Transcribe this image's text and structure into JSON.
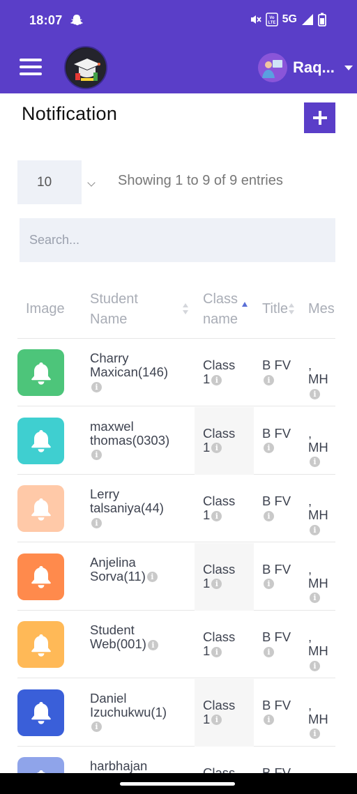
{
  "status_bar": {
    "time": "18:07",
    "network": "5G",
    "icons": [
      "snapchat-icon",
      "mute-icon",
      "volte-icon",
      "signal-icon",
      "battery-icon"
    ]
  },
  "app_bar": {
    "user_name": "Raq...",
    "icons": [
      "menu-icon",
      "school-logo",
      "avatar",
      "caret-down-icon"
    ]
  },
  "page": {
    "title": "Notification",
    "add_icon": "plus-icon"
  },
  "controls": {
    "page_size": "10",
    "entries_info": "Showing 1 to 9 of 9 entries",
    "search_placeholder": "Search..."
  },
  "table": {
    "headers": {
      "image": "Image",
      "student_name_1": "Student",
      "student_name_2": "Name",
      "class_name_1": "Class",
      "class_name_2": "name",
      "title": "Title",
      "message": "Mes"
    },
    "rows": [
      {
        "bell_color": "#4dc57a",
        "name_1": "Charry",
        "name_2": "Maxican(146)",
        "class_1": "Class",
        "class_2": "1",
        "title": "B FV",
        "message": ", MH"
      },
      {
        "bell_color": "#3fcfd0",
        "name_1": "maxwel",
        "name_2": "thomas(0303)",
        "class_1": "Class",
        "class_2": "1",
        "title": "B FV",
        "message": ", MH"
      },
      {
        "bell_color": "#ffc9a8",
        "name_1": "Lerry",
        "name_2": "talsaniya(44)",
        "class_1": "Class",
        "class_2": "1",
        "title": "B FV",
        "message": ", MH"
      },
      {
        "bell_color": "#ff8a4c",
        "name_1": "Anjelina",
        "name_2": "Sorva(11)",
        "class_1": "Class",
        "class_2": "1",
        "title": "B FV",
        "message": ", MH"
      },
      {
        "bell_color": "#ffb957",
        "name_1": "Student",
        "name_2": "Web(001)",
        "class_1": "Class",
        "class_2": "1",
        "title": "B FV",
        "message": ", MH"
      },
      {
        "bell_color": "#3a5fd9",
        "name_1": "Daniel",
        "name_2": "Izuchukwu(1)",
        "class_1": "Class",
        "class_2": "1",
        "title": "B FV",
        "message": ", MH"
      },
      {
        "bell_color": "#8fa4ea",
        "name_1": "harbhajan",
        "name_2": "",
        "class_1": "Class",
        "class_2": "",
        "title": "B FV",
        "message": ", MH"
      }
    ]
  },
  "colors": {
    "primary": "#5a3ec8",
    "header_text": "#a9adb6"
  }
}
